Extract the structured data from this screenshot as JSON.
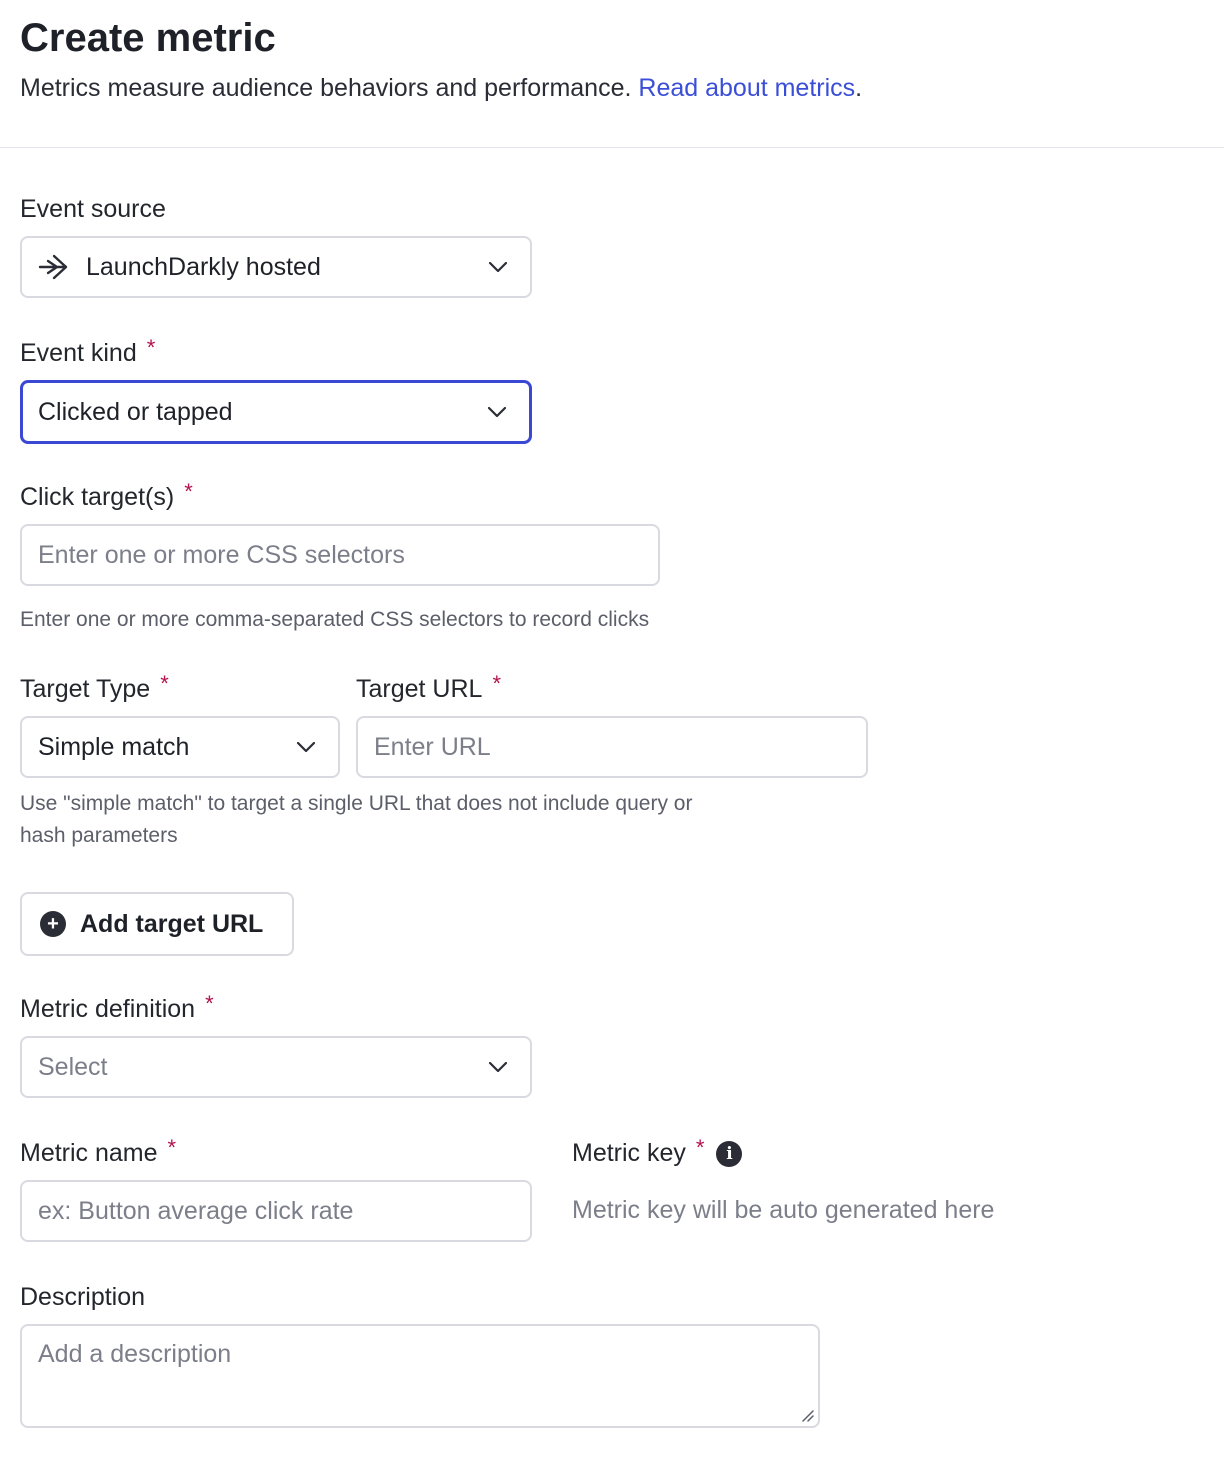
{
  "header": {
    "title": "Create metric",
    "subtitle": "Metrics measure audience behaviors and performance.",
    "link_text": "Read about metrics",
    "link_suffix": "."
  },
  "event_source": {
    "label": "Event source",
    "value": "LaunchDarkly hosted",
    "icon": "launchdarkly-arrow-icon"
  },
  "event_kind": {
    "label": "Event kind",
    "required": "*",
    "value": "Clicked or tapped"
  },
  "click_targets": {
    "label": "Click target(s)",
    "required": "*",
    "placeholder": "Enter one or more CSS selectors",
    "help": "Enter one or more comma-separated CSS selectors to record clicks"
  },
  "target_type": {
    "label": "Target Type",
    "required": "*",
    "value": "Simple match"
  },
  "target_url": {
    "label": "Target URL",
    "required": "*",
    "placeholder": "Enter URL"
  },
  "target_help_line1": "Use \"simple match\" to target a single URL that does not include query or",
  "target_help_line2": "hash parameters",
  "add_target_button": {
    "label": "Add target URL",
    "icon": "+"
  },
  "metric_definition": {
    "label": "Metric definition",
    "required": "*",
    "placeholder": "Select"
  },
  "metric_name": {
    "label": "Metric name",
    "required": "*",
    "placeholder": "ex: Button average click rate"
  },
  "metric_key": {
    "label": "Metric key",
    "required": "*",
    "info_icon": "i",
    "placeholder": "Metric key will be auto generated here"
  },
  "description": {
    "label": "Description",
    "placeholder": "Add a description"
  },
  "colors": {
    "accent": "#3b48d4",
    "link": "#3b4ed8",
    "required": "#b3124e",
    "border": "#d9dae0"
  }
}
